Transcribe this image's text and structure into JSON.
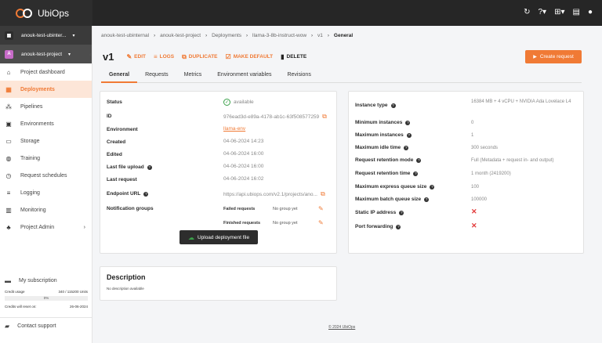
{
  "app": {
    "name": "UbiOps"
  },
  "topbar": {
    "icons": [
      "logout-icon",
      "help-icon",
      "add-icon",
      "docs-icon",
      "user-icon"
    ]
  },
  "sidebar": {
    "org_selector": {
      "badge": "",
      "label": "anouk-test-ubinter..."
    },
    "project_selector": {
      "badge": "A",
      "label": "anouk-test-project"
    },
    "items": [
      {
        "label": "Project dashboard",
        "icon": "home-icon"
      },
      {
        "label": "Deployments",
        "icon": "grid-icon"
      },
      {
        "label": "Pipelines",
        "icon": "pipeline-icon"
      },
      {
        "label": "Environments",
        "icon": "server-icon"
      },
      {
        "label": "Storage",
        "icon": "folder-icon"
      },
      {
        "label": "Training",
        "icon": "training-icon"
      },
      {
        "label": "Request schedules",
        "icon": "clock-icon"
      },
      {
        "label": "Logging",
        "icon": "list-icon"
      },
      {
        "label": "Monitoring",
        "icon": "chart-icon"
      },
      {
        "label": "Project Admin",
        "icon": "users-icon"
      }
    ],
    "subscription": {
      "title": "My subscription",
      "credit_usage_label": "Credit usage",
      "credit_usage_value": "340 / 115200 Units",
      "progress_text": "0%",
      "progress": 0,
      "reset_label": "Credits will reset on:",
      "reset_value": "26-06-2024"
    },
    "contact": "Contact support"
  },
  "breadcrumb": [
    "anouk-test-ubinternal",
    "anouk-test-project",
    "Deployments",
    "llama-3-8b-instruct-wow",
    "v1",
    "General"
  ],
  "header": {
    "title": "v1",
    "actions": [
      "EDIT",
      "LOGS",
      "DUPLICATE",
      "MAKE DEFAULT",
      "DELETE"
    ],
    "create_request": "Create request"
  },
  "tabs": [
    "General",
    "Requests",
    "Metrics",
    "Environment variables",
    "Revisions"
  ],
  "details": {
    "status_label": "Status",
    "status_value": "available",
    "id_label": "ID",
    "id_value": "976ead3d-e89a-4178-ab1c-63f508577259",
    "environment_label": "Environment",
    "environment_value": "llama-env",
    "created_label": "Created",
    "created_value": "04-06-2024 14:23",
    "edited_label": "Edited",
    "edited_value": "04-06-2024 16:00",
    "last_upload_label": "Last file upload",
    "last_upload_value": "04-06-2024 16:00",
    "last_request_label": "Last request",
    "last_request_value": "04-06-2024 16:02",
    "endpoint_label": "Endpoint URL",
    "endpoint_value": "https://api.ubiops.com/v2.1/projects/ano...",
    "notification_label": "Notification groups",
    "failed_label": "Failed requests",
    "failed_value": "No group yet",
    "finished_label": "Finished requests",
    "finished_value": "No group yet",
    "upload_button": "Upload deployment file"
  },
  "instance": {
    "rows": [
      {
        "label": "Instance type",
        "value": "16384 MB + 4 vCPU + NVIDIA Ada Lovelace L4",
        "help": true
      },
      {
        "label": "Minimum instances",
        "value": "0",
        "help": true
      },
      {
        "label": "Maximum instances",
        "value": "1",
        "help": true
      },
      {
        "label": "Maximum idle time",
        "value": "300 seconds",
        "help": true
      },
      {
        "label": "Request retention mode",
        "value": "Full (Metadata + request in- and output)",
        "help": true
      },
      {
        "label": "Request retention time",
        "value": "1 month (2419200)",
        "help": true
      },
      {
        "label": "Maximum express queue size",
        "value": "100",
        "help": true
      },
      {
        "label": "Maximum batch queue size",
        "value": "100000",
        "help": true
      },
      {
        "label": "Static IP address",
        "value": "✕",
        "help": true
      },
      {
        "label": "Port forwarding",
        "value": "✕",
        "help": true
      }
    ]
  },
  "description": {
    "title": "Description",
    "text": "No description available"
  },
  "footer": "© 2024 UbiOps",
  "colors": {
    "accent": "#f07a35",
    "topbar": "#262626",
    "success": "#3aa14a",
    "danger": "#e23a3a"
  }
}
